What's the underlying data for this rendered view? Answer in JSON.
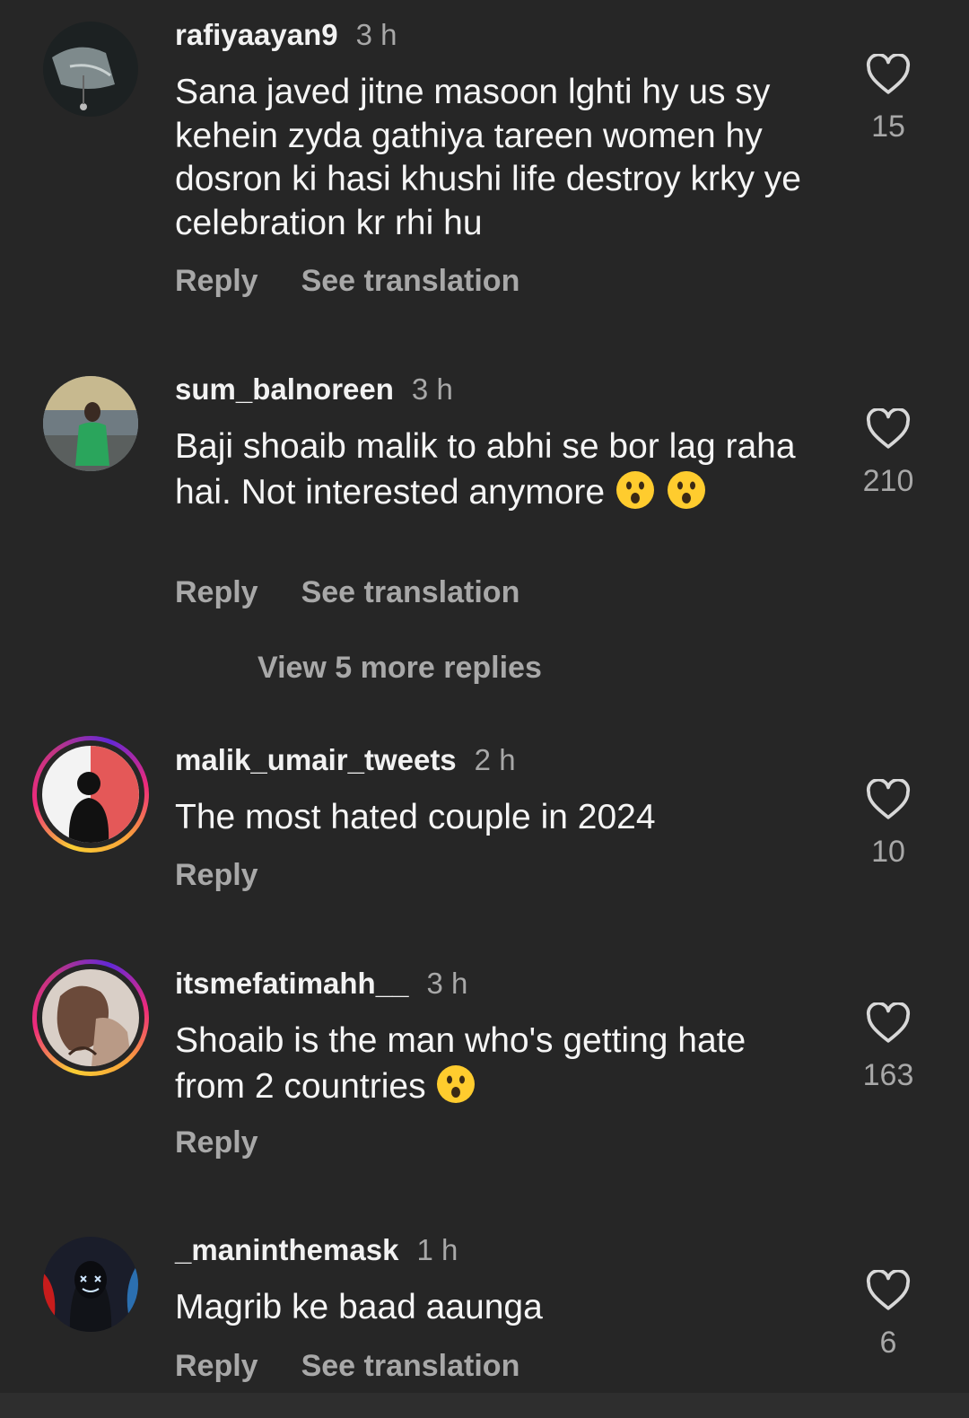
{
  "comments": [
    {
      "username": "rafiyaayan9",
      "time": "3 h",
      "text": "Sana javed jitne masoon lghti hy us sy kehein zyda gathiya tareen women hy dosron ki hasi khushi life destroy krky ye celebration kr rhi hu",
      "likes": "15",
      "reply_label": "Reply",
      "translate_label": "See translation"
    },
    {
      "username": "sum_balnoreen",
      "time": "3 h",
      "text": "Baji shoaib malik to abhi se bor lag raha hai. Not interested anymore",
      "likes": "210",
      "reply_label": "Reply",
      "translate_label": "See translation",
      "view_replies": "View 5 more replies"
    },
    {
      "username": "malik_umair_tweets",
      "time": "2 h",
      "text": "The most hated couple in 2024",
      "likes": "10",
      "reply_label": "Reply"
    },
    {
      "username": "itsmefatimahh__",
      "time": "3 h",
      "text": "Shoaib is the man who's getting hate from 2 countries",
      "likes": "163",
      "reply_label": "Reply"
    },
    {
      "username": "_maninthemask",
      "time": "1 h",
      "text": "Magrib ke baad aaunga",
      "likes": "6",
      "reply_label": "Reply",
      "translate_label": "See translation"
    }
  ],
  "icons": {
    "like": "heart-outline-icon",
    "emoji": "astonished-face-emoji"
  },
  "colors": {
    "background": "#262626",
    "secondary_text": "#a8a8a8",
    "story_ring_start": "#f9ce34",
    "story_ring_end": "#ee2a7b"
  }
}
